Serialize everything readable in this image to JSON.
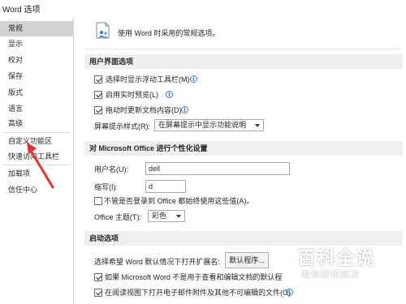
{
  "window": {
    "title": "Word 选项"
  },
  "sidebar": {
    "items": [
      {
        "label": "常规",
        "selected": true
      },
      {
        "label": "显示"
      },
      {
        "label": "校对"
      },
      {
        "label": "保存"
      },
      {
        "label": "版式"
      },
      {
        "label": "语言"
      },
      {
        "label": "高级"
      },
      {
        "label": "自定义功能区"
      },
      {
        "label": "快速访问工具栏"
      },
      {
        "label": "加载项"
      },
      {
        "label": "信任中心"
      }
    ]
  },
  "main": {
    "intro": "使用 Word 时采用的常规选项。",
    "ui_section": {
      "title": "用户界面选项",
      "options": [
        {
          "label": "选择时显示浮动工具栏(M)",
          "checked": true
        },
        {
          "label": "启用实时预览(L)",
          "checked": true
        },
        {
          "label": "拖动时更新文档内容(D)",
          "checked": true
        }
      ],
      "tooltip_label": "屏幕提示样式(R):",
      "tooltip_value": "在屏幕提示中显示功能说明"
    },
    "personalize_section": {
      "title": "对 Microsoft Office 进行个性化设置",
      "username_label": "用户名(U):",
      "username_value": "dell",
      "initials_label": "缩写(I):",
      "initials_value": "d",
      "always_use_label": "不管是否登录到 Office 都始终使用这些值(A)。",
      "always_use_checked": false,
      "theme_label": "Office 主题(T):",
      "theme_value": "彩色"
    },
    "startup_section": {
      "title": "启动选项",
      "default_program_label": "选择希望 Word 默认情况下打开扩展名:",
      "default_program_button": "默认程序...",
      "options": [
        {
          "label": "如果 Microsoft Word 不是用于查看和编辑文档的默认程",
          "checked": true
        },
        {
          "label": "在阅读视图下打开电子邮件附件及其他不可编辑的文件(O)",
          "checked": true
        }
      ]
    }
  },
  "watermark": {
    "main": "百科全说",
    "sub": "助你轻松解决"
  },
  "colors": {
    "selected_nav": "#d3d3d3",
    "section_header": "#efefef",
    "arrow": "#e8312f",
    "info": "#3d7cc9"
  },
  "icons": [
    "options-general-icon",
    "info-icon",
    "dropdown-caret-icon",
    "red-arrow-annotation"
  ]
}
